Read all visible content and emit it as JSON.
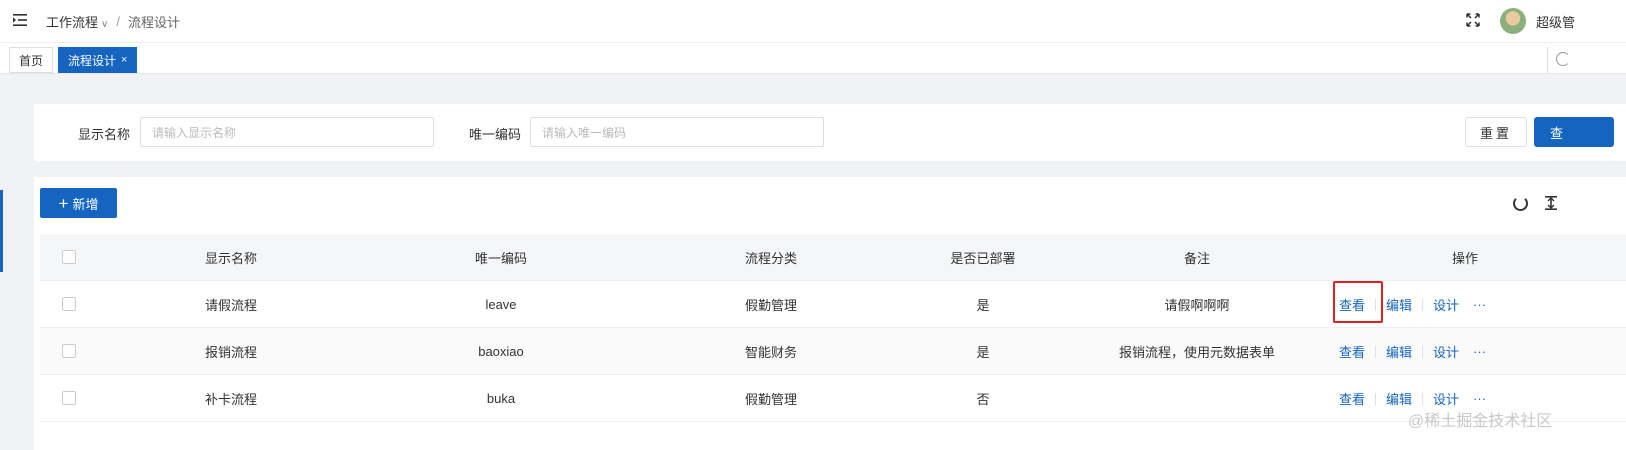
{
  "header": {
    "breadcrumb": [
      "工作流程",
      "流程设计"
    ],
    "breadcrumb_sep": "/",
    "username": "超级管"
  },
  "tabs": [
    {
      "label": "首页"
    },
    {
      "label": "流程设计",
      "close": "×"
    }
  ],
  "search": {
    "fields": [
      {
        "label": "显示名称",
        "placeholder": "请输入显示名称"
      },
      {
        "label": "唯一编码",
        "placeholder": "请输入唯一编码"
      }
    ],
    "reset_label": "重置",
    "query_label": "查"
  },
  "toolbar": {
    "add_label": "新增"
  },
  "table": {
    "columns": [
      "显示名称",
      "唯一编码",
      "流程分类",
      "是否已部署",
      "备注",
      "操作"
    ],
    "rows": [
      {
        "name": "请假流程",
        "code": "leave",
        "category": "假勤管理",
        "deployed": "是",
        "remark": "请假啊啊啊"
      },
      {
        "name": "报销流程",
        "code": "baoxiao",
        "category": "智能财务",
        "deployed": "是",
        "remark": "报销流程，使用元数据表单"
      },
      {
        "name": "补卡流程",
        "code": "buka",
        "category": "假勤管理",
        "deployed": "否",
        "remark": ""
      }
    ],
    "row_actions": {
      "view": "查看",
      "edit": "编辑",
      "design": "设计",
      "more": "···"
    }
  },
  "colors": {
    "primary": "#1565c0",
    "highlight": "#e02020"
  },
  "watermark": "@稀土掘金技术社区"
}
